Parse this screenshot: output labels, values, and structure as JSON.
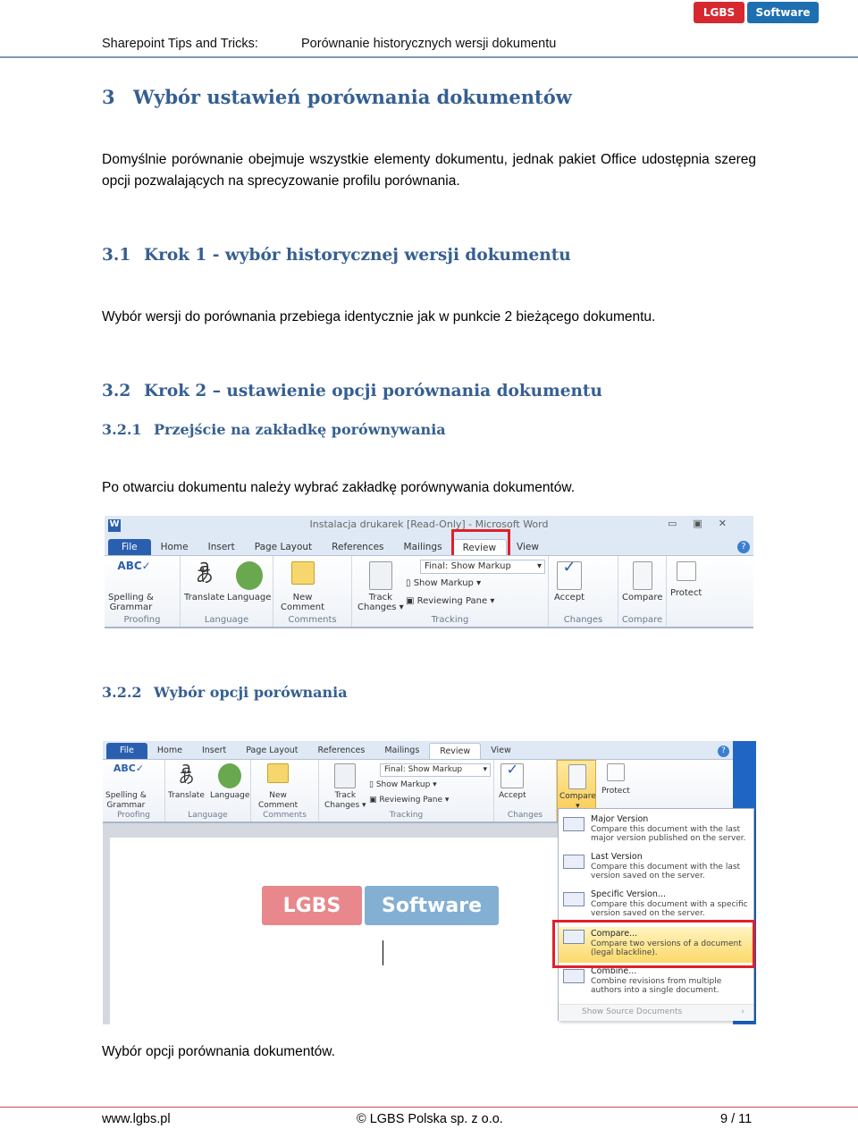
{
  "header": {
    "left": "Sharepoint Tips and Tricks:",
    "right": "Porównanie historycznych wersji dokumentu",
    "logo": {
      "part1": "LGBS",
      "part2": "Software",
      "red": "#d7282f",
      "blue": "#1e6fb0"
    }
  },
  "section3": {
    "num": "3",
    "title": "Wybór ustawień porównania dokumentów",
    "body": "Domyślnie porównanie obejmuje wszystkie elementy dokumentu, jednak pakiet Office udostępnia szereg opcji pozwalających na sprecyzowanie profilu porównania."
  },
  "section31": {
    "num": "3.1",
    "title": "Krok 1 - wybór historycznej wersji dokumentu",
    "body": "Wybór wersji do porównania przebiega identycznie jak w punkcie 2 bieżącego dokumentu."
  },
  "section32": {
    "num": "3.2",
    "title": "Krok 2 – ustawienie opcji porównania dokumentu"
  },
  "section321": {
    "num": "3.2.1",
    "title": "Przejście na zakładkę porównywania",
    "body": "Po otwarciu dokumentu należy wybrać zakładkę porównywania dokumentów."
  },
  "section322": {
    "num": "3.2.2",
    "title": "Wybór opcji porównania",
    "caption": "Wybór opcji porównania dokumentów."
  },
  "word": {
    "window_title": "Instalacja drukarek [Read-Only]  -  Microsoft Word",
    "tabs": [
      "File",
      "Home",
      "Insert",
      "Page Layout",
      "References",
      "Mailings",
      "Review",
      "View"
    ],
    "active_tab": "Review",
    "groups": {
      "proofing": "Proofing",
      "language": "Language",
      "comments": "Comments",
      "tracking": "Tracking",
      "changes": "Changes",
      "compare": "Compare"
    },
    "buttons": {
      "spelling": "Spelling &",
      "grammar": "Grammar",
      "translate": "Translate",
      "language": "Language",
      "new": "New",
      "comment": "Comment",
      "track": "Track",
      "changes": "Changes",
      "final_markup": "Final: Show Markup",
      "show_markup": "Show Markup",
      "reviewing_pane": "Reviewing Pane",
      "accept": "Accept",
      "compare": "Compare",
      "protect": "Protect"
    },
    "compare_menu": [
      {
        "title": "Major Version",
        "desc": "Compare this document with the last major version published on the server.",
        "icon": "1.0|1.8"
      },
      {
        "title": "Last Version",
        "desc": "Compare this document with the last version saved on the server.",
        "icon": "1.7|1.8"
      },
      {
        "title": "Specific Version...",
        "desc": "Compare this document with a specific version saved on the server.",
        "icon": "1.3|1.5"
      },
      {
        "title": "Compare...",
        "desc": "Compare two versions of a document (legal blackline).",
        "icon": ""
      },
      {
        "title": "Combine...",
        "desc": "Combine revisions from multiple authors into a single document.",
        "icon": ""
      }
    ],
    "show_source": "Show Source Documents",
    "highlight_color": "#e0202a"
  },
  "footer": {
    "left": "www.lgbs.pl",
    "center": "© LGBS Polska sp. z o.o.",
    "right": "9 / 11"
  }
}
